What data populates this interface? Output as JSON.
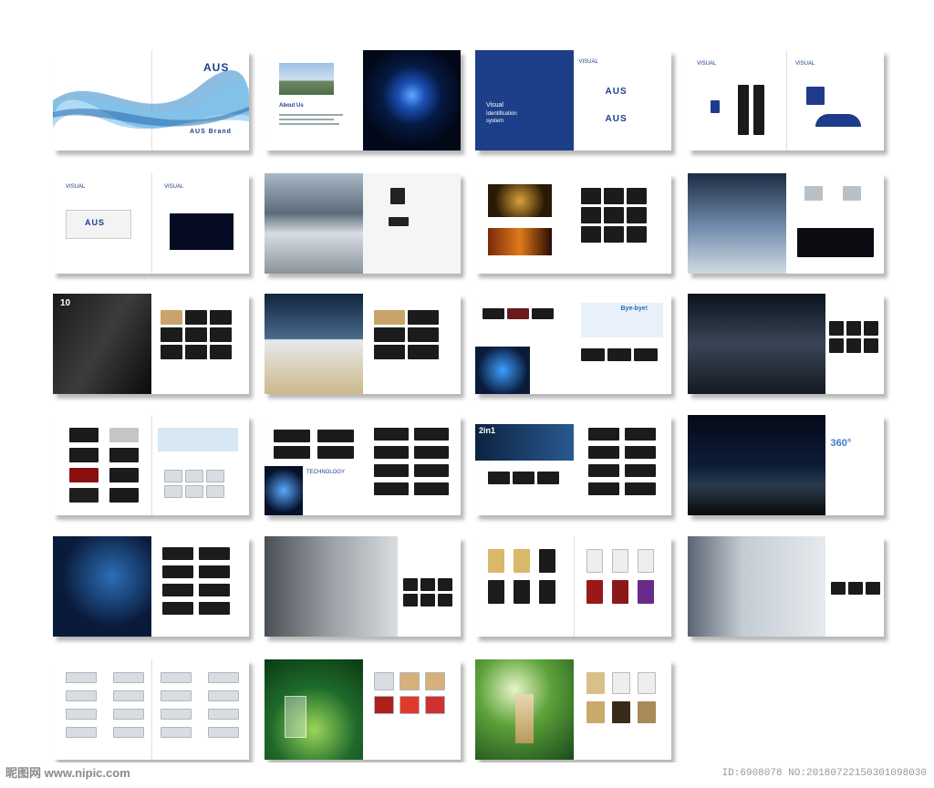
{
  "brand": "AUS",
  "spreads": {
    "s1": {
      "logo": "AUS",
      "tag": "AUS Brand"
    },
    "s2": {
      "heading": "About Us"
    },
    "s3": {
      "title_1": "Visual",
      "title_2": "Identification",
      "title_3": "system",
      "right_title": "VISUAL",
      "logo": "AUS"
    },
    "s4": {
      "title": "VISUAL"
    },
    "s5": {
      "title_l": "VISUAL",
      "title_r": "VISUAL",
      "truck_logo": "AUS"
    },
    "s9": {
      "big": "10"
    },
    "s11": {
      "banner": "Bye-bye!"
    },
    "s14": {
      "banner": "TECHNOLOGY"
    },
    "s15": {
      "banner": "2in1"
    },
    "s16": {
      "big": "360°"
    }
  },
  "watermark": {
    "site": "昵图网 www.nipic.com",
    "id": "ID:6908078 NO:20180722150301098030"
  }
}
